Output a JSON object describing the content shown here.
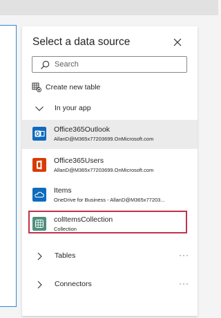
{
  "dialog": {
    "title": "Select a data source",
    "close_icon": "close-icon"
  },
  "search": {
    "placeholder": "Search",
    "value": "",
    "icon": "search-icon"
  },
  "create_new_table": {
    "label": "Create new table",
    "icon": "table-add-icon"
  },
  "sections": {
    "in_your_app": {
      "label": "In your app",
      "expanded": true
    },
    "tables": {
      "label": "Tables",
      "expanded": false,
      "more": "···"
    },
    "connectors": {
      "label": "Connectors",
      "expanded": false,
      "more": "···"
    }
  },
  "items": [
    {
      "name": "Office365Outlook",
      "subtitle": "AllanD@M365x77203699.OnMicrosoft.com",
      "icon": "outlook-icon",
      "color": "#0f6cbd",
      "selected": true
    },
    {
      "name": "Office365Users",
      "subtitle": "AllanD@M365x77203699.OnMicrosoft.com",
      "icon": "office-icon",
      "color": "#d83b01",
      "selected": false
    },
    {
      "name": "Items",
      "subtitle": "OneDrive for Business - AllanD@M365x77203...",
      "icon": "cloud-icon",
      "color": "#0f6cbd",
      "selected": false
    },
    {
      "name": "colItemsCollection",
      "subtitle": "Collection",
      "icon": "collection-grid-icon",
      "color": "#4f8f7e",
      "selected": false,
      "highlighted": true
    }
  ],
  "colors": {
    "accent_border": "#2b88d8",
    "highlight_box": "#c4314b",
    "selected_row": "#ebebeb"
  }
}
